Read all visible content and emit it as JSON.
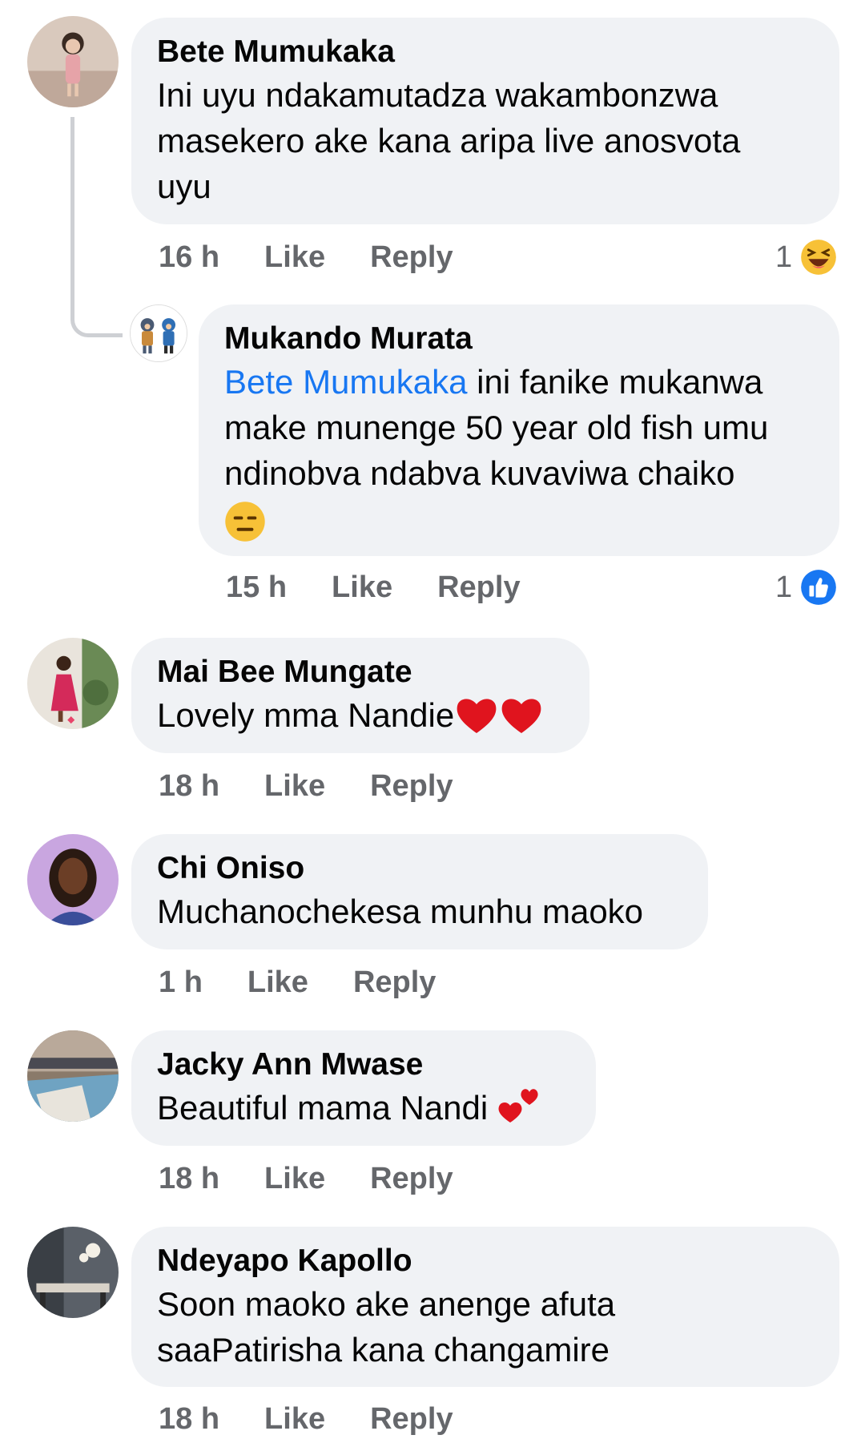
{
  "comments": [
    {
      "author": "Bete Mumukaka",
      "text_lines": [
        "Ini uyu ndakamutadza wakambonzwa",
        "masekero ake kana aripa live anosvota",
        "uyu"
      ],
      "time": "16 h",
      "like_label": "Like",
      "reply_label": "Reply",
      "reaction_count": "1",
      "reaction_icon": "laughing-face-icon",
      "avatar_icon": "child-photo-avatar"
    },
    {
      "author": "Mukando Murata",
      "mention": "Bete Mumukaka",
      "text_after_mention": " ini fanike mukanwa",
      "text_lines": [
        "make munenge 50 year old fish umu",
        "ndinobva ndabva kuvaviwa chaiko"
      ],
      "emoji": "expressionless-face-icon",
      "time": "15 h",
      "like_label": "Like",
      "reply_label": "Reply",
      "reaction_count": "1",
      "reaction_icon": "like-thumb-icon",
      "avatar_icon": "cartoon-figures-avatar"
    },
    {
      "author": "Mai Bee Mungate",
      "text": "Lovely mma Nandie",
      "emoji": "two-red-hearts-icon",
      "time": "18 h",
      "like_label": "Like",
      "reply_label": "Reply",
      "avatar_icon": "woman-red-dress-avatar"
    },
    {
      "author": "Chi Oniso",
      "text": "Muchanochekesa munhu maoko",
      "time": "1 h",
      "like_label": "Like",
      "reply_label": "Reply",
      "avatar_icon": "woman-portrait-avatar"
    },
    {
      "author": "Jacky Ann Mwase",
      "text": "Beautiful mama Nandi ",
      "emoji": "two-hearts-icon",
      "time": "18 h",
      "like_label": "Like",
      "reply_label": "Reply",
      "avatar_icon": "pool-photo-avatar"
    },
    {
      "author": "Ndeyapo Kapollo",
      "text_lines": [
        "Soon maoko ake anenge afuta",
        "saaPatirisha kana changamire"
      ],
      "time": "18 h",
      "like_label": "Like",
      "reply_label": "Reply",
      "avatar_icon": "dining-room-avatar"
    }
  ],
  "colors": {
    "bubble": "#f0f2f5",
    "mention": "#1877f2",
    "meta": "#65676b",
    "like_blue": "#1877f2"
  }
}
